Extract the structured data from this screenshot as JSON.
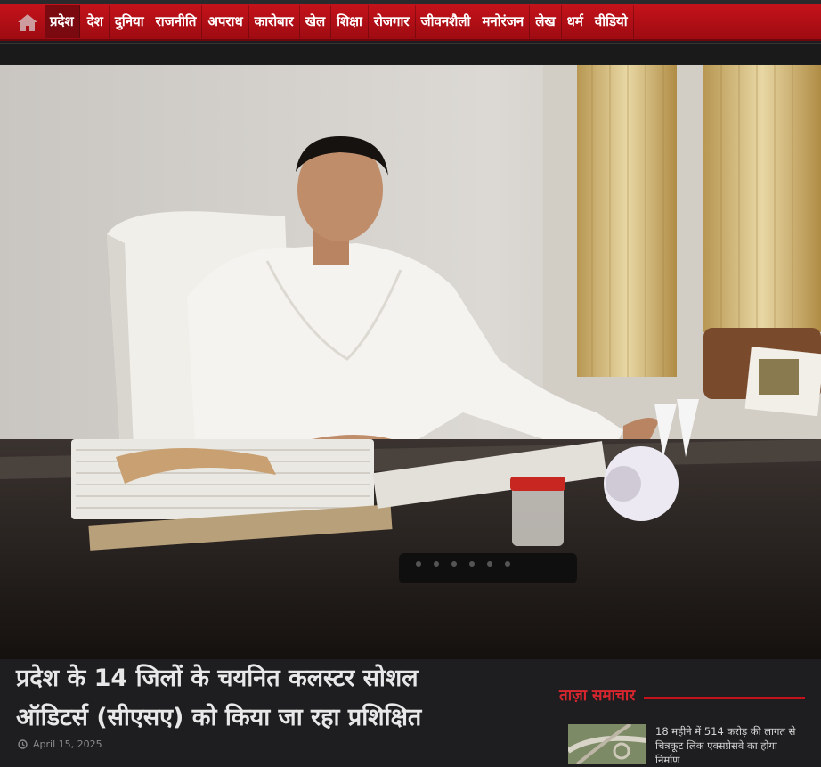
{
  "nav": {
    "home_icon": "home-icon",
    "items": [
      {
        "label": "प्रदेश",
        "active": true
      },
      {
        "label": "देश"
      },
      {
        "label": "दुनिया"
      },
      {
        "label": "राजनीति"
      },
      {
        "label": "अपराध"
      },
      {
        "label": "कारोबार"
      },
      {
        "label": "खेल"
      },
      {
        "label": "शिक्षा"
      },
      {
        "label": "रोजगार"
      },
      {
        "label": "जीवनशैली"
      },
      {
        "label": "मनोरंजन"
      },
      {
        "label": "लेख"
      },
      {
        "label": "धर्म"
      },
      {
        "label": "वीडियो"
      }
    ]
  },
  "article": {
    "title_line1": "प्रदेश के 14 जिलों के चयनित कलस्टर सोशल",
    "title_line2": "ऑडिटर्स (सीएसए) को किया जा रहा प्रशिक्षित",
    "date": "April 15, 2025",
    "date_icon": "clock-icon"
  },
  "sidebar": {
    "title": "ताज़ा समाचार",
    "news": [
      {
        "title": "18 महीने में 514 करोड़ की लागत से चित्रकूट लिंक एक्सप्रेसवे का होगा निर्माण"
      }
    ]
  },
  "colors": {
    "accent": "#c4121a",
    "background": "#1e1e20"
  }
}
